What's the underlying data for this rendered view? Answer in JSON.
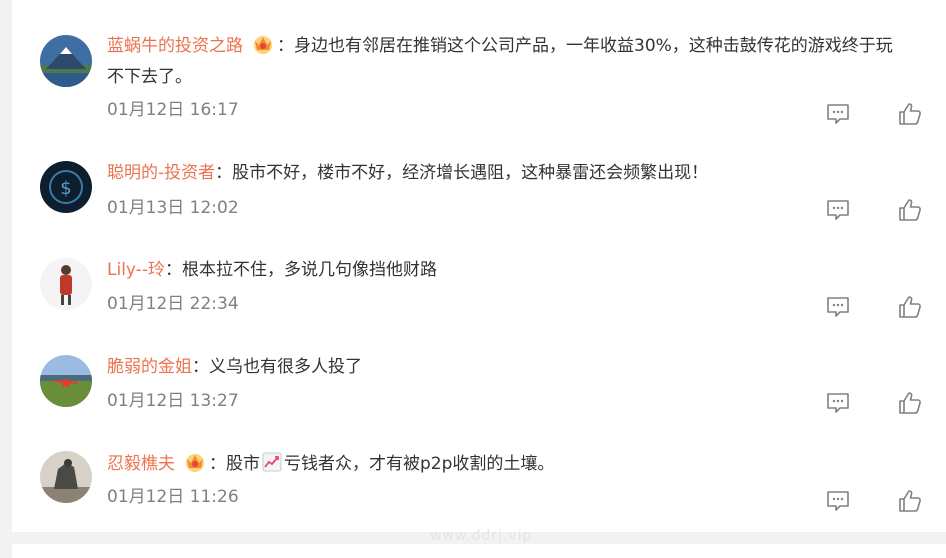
{
  "comments": [
    {
      "username": "蓝蜗牛的投资之路",
      "has_vip": true,
      "text_before": "：身边也有邻居在推销这个公司产品，一年收益30%，这种击鼓传花的游戏终于玩",
      "text_after": "不下去了。",
      "time": "01月12日 16:17"
    },
    {
      "username": "聪明的-投资者",
      "has_vip": false,
      "text_before": "：股市不好，楼市不好，经济增长遇阻，这种暴雷还会频繁出现！",
      "time": "01月13日 12:02"
    },
    {
      "username": "Lily--玲",
      "has_vip": false,
      "text_before": "：根本拉不住，多说几句像挡他财路",
      "time": "01月12日 22:34"
    },
    {
      "username": "脆弱的金姐",
      "has_vip": false,
      "text_before": "：义乌也有很多人投了",
      "time": "01月12日 13:27"
    },
    {
      "username": "忍毅樵夫",
      "has_vip": true,
      "text_before": "：股市",
      "text_after": "亏钱者众，才有被p2p收割的土壤。",
      "inline_icon": "chart-up-emoji-icon",
      "time": "01月12日 11:26"
    }
  ],
  "icons": {
    "reply": "comment-icon",
    "like": "thumbs-up-icon",
    "vip": "crown-badge-icon"
  },
  "colors": {
    "username": "#eb7350",
    "text": "#333333",
    "time": "#808080",
    "icon": "#808080"
  },
  "watermark": "www.ddrj.vip"
}
